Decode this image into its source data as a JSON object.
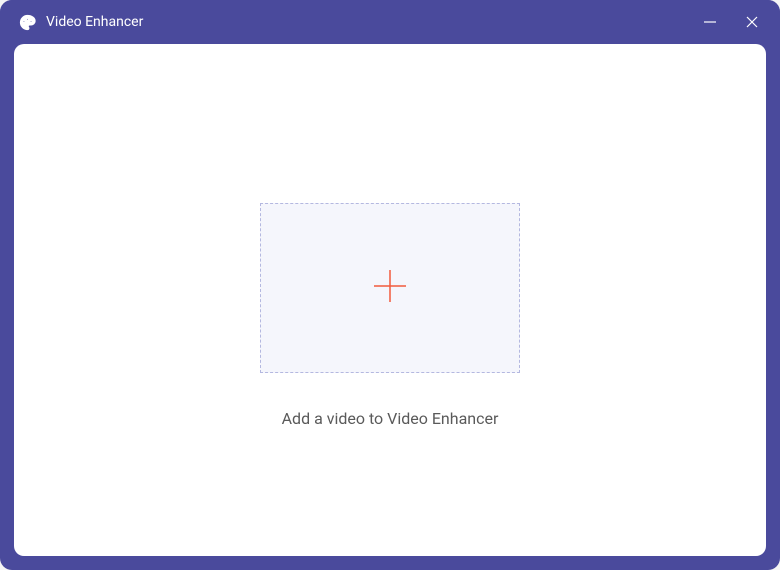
{
  "window": {
    "title": "Video Enhancer"
  },
  "main": {
    "instruction": "Add a video to Video Enhancer"
  },
  "colors": {
    "brand": "#4a4a9c",
    "accent": "#f25a3c",
    "dropBorder": "#b4b8e0",
    "dropBg": "#f5f6fc"
  }
}
